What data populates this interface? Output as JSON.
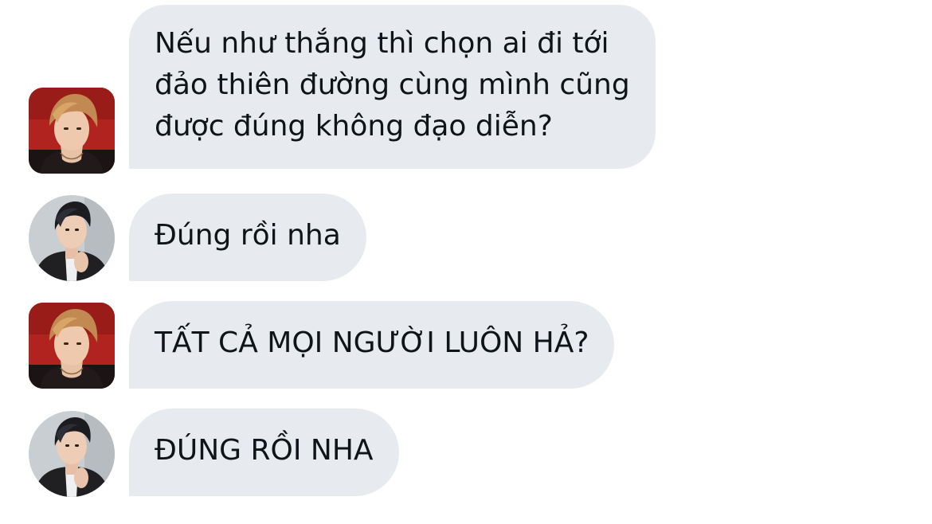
{
  "messages": [
    {
      "sender": "a",
      "lines": [
        "Nếu như thắng thì chọn ai đi tới",
        "đảo thiên đường cùng mình cũng",
        "được đúng không đạo diễn?"
      ]
    },
    {
      "sender": "b",
      "lines": [
        "Đúng rồi nha"
      ]
    },
    {
      "sender": "a",
      "lines": [
        "TẤT CẢ MỌI NGƯỜI LUÔN HẢ?"
      ]
    },
    {
      "sender": "b",
      "lines": [
        "ĐÚNG RỒI NHA"
      ]
    }
  ],
  "colors": {
    "bubble_bg": "#e7ebef",
    "text": "#0f1419",
    "background": "#ffffff"
  }
}
